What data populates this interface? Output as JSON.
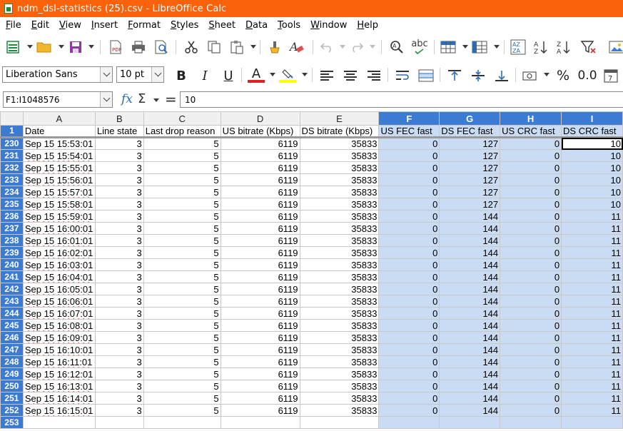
{
  "window": {
    "title": "ndm_dsl-statistics (25).csv - LibreOffice Calc"
  },
  "menu": [
    "File",
    "Edit",
    "View",
    "Insert",
    "Format",
    "Styles",
    "Sheet",
    "Data",
    "Tools",
    "Window",
    "Help"
  ],
  "toolbar": {
    "icons": [
      "new-icon",
      "open-icon",
      "save-icon",
      "export-pdf-icon",
      "print-icon",
      "print-preview-icon",
      "cut-icon",
      "copy-icon",
      "paste-icon",
      "clone-formatting-icon",
      "clear-formatting-icon",
      "undo-icon",
      "redo-icon",
      "find-replace-icon",
      "spelling-icon",
      "row-icon",
      "column-icon",
      "sort-icon",
      "sort-ascending-icon",
      "sort-descending-icon",
      "autofilter-icon",
      "image-icon"
    ],
    "spelling_label": "abc"
  },
  "format": {
    "font_name": "Liberation Sans",
    "font_size": "10 pt",
    "bold_label": "B",
    "italic_label": "I",
    "underline_label": "U",
    "font_color_label": "A",
    "font_color": "#e02020",
    "highlight_color": "#ffff00",
    "percent_label": "%",
    "decimal_label": "0.0"
  },
  "formula": {
    "name_box": "F1:I1048576",
    "fx_label": "fx",
    "sum_label": "Σ",
    "equals_label": "=",
    "content": "10"
  },
  "sheet": {
    "columns": [
      "A",
      "B",
      "C",
      "D",
      "E",
      "F",
      "G",
      "H",
      "I"
    ],
    "selected_columns": [
      "F",
      "G",
      "H",
      "I"
    ],
    "header_row_number": "1",
    "headers": [
      "Date",
      "Line state",
      "Last drop reason",
      "US bitrate (Kbps)",
      "DS bitrate (Kbps)",
      "US FEC fast",
      "DS FEC fast",
      "US CRC fast",
      "DS CRC fast"
    ],
    "rows": [
      {
        "n": "230",
        "cells": [
          "Sep 15 15:53:01",
          "3",
          "5",
          "6119",
          "35833",
          "0",
          "127",
          "0",
          "10"
        ]
      },
      {
        "n": "231",
        "cells": [
          "Sep 15 15:54:01",
          "3",
          "5",
          "6119",
          "35833",
          "0",
          "127",
          "0",
          "10"
        ]
      },
      {
        "n": "232",
        "cells": [
          "Sep 15 15:55:01",
          "3",
          "5",
          "6119",
          "35833",
          "0",
          "127",
          "0",
          "10"
        ]
      },
      {
        "n": "233",
        "cells": [
          "Sep 15 15:56:01",
          "3",
          "5",
          "6119",
          "35833",
          "0",
          "127",
          "0",
          "10"
        ]
      },
      {
        "n": "234",
        "cells": [
          "Sep 15 15:57:01",
          "3",
          "5",
          "6119",
          "35833",
          "0",
          "127",
          "0",
          "10"
        ]
      },
      {
        "n": "235",
        "cells": [
          "Sep 15 15:58:01",
          "3",
          "5",
          "6119",
          "35833",
          "0",
          "127",
          "0",
          "10"
        ]
      },
      {
        "n": "236",
        "cells": [
          "Sep 15 15:59:01",
          "3",
          "5",
          "6119",
          "35833",
          "0",
          "144",
          "0",
          "11"
        ]
      },
      {
        "n": "237",
        "cells": [
          "Sep 15 16:00:01",
          "3",
          "5",
          "6119",
          "35833",
          "0",
          "144",
          "0",
          "11"
        ]
      },
      {
        "n": "238",
        "cells": [
          "Sep 15 16:01:01",
          "3",
          "5",
          "6119",
          "35833",
          "0",
          "144",
          "0",
          "11"
        ]
      },
      {
        "n": "239",
        "cells": [
          "Sep 15 16:02:01",
          "3",
          "5",
          "6119",
          "35833",
          "0",
          "144",
          "0",
          "11"
        ]
      },
      {
        "n": "240",
        "cells": [
          "Sep 15 16:03:01",
          "3",
          "5",
          "6119",
          "35833",
          "0",
          "144",
          "0",
          "11"
        ]
      },
      {
        "n": "241",
        "cells": [
          "Sep 15 16:04:01",
          "3",
          "5",
          "6119",
          "35833",
          "0",
          "144",
          "0",
          "11"
        ]
      },
      {
        "n": "242",
        "cells": [
          "Sep 15 16:05:01",
          "3",
          "5",
          "6119",
          "35833",
          "0",
          "144",
          "0",
          "11"
        ]
      },
      {
        "n": "243",
        "cells": [
          "Sep 15 16:06:01",
          "3",
          "5",
          "6119",
          "35833",
          "0",
          "144",
          "0",
          "11"
        ]
      },
      {
        "n": "244",
        "cells": [
          "Sep 15 16:07:01",
          "3",
          "5",
          "6119",
          "35833",
          "0",
          "144",
          "0",
          "11"
        ]
      },
      {
        "n": "245",
        "cells": [
          "Sep 15 16:08:01",
          "3",
          "5",
          "6119",
          "35833",
          "0",
          "144",
          "0",
          "11"
        ]
      },
      {
        "n": "246",
        "cells": [
          "Sep 15 16:09:01",
          "3",
          "5",
          "6119",
          "35833",
          "0",
          "144",
          "0",
          "11"
        ]
      },
      {
        "n": "247",
        "cells": [
          "Sep 15 16:10:01",
          "3",
          "5",
          "6119",
          "35833",
          "0",
          "144",
          "0",
          "11"
        ]
      },
      {
        "n": "248",
        "cells": [
          "Sep 15 16:11:01",
          "3",
          "5",
          "6119",
          "35833",
          "0",
          "144",
          "0",
          "11"
        ]
      },
      {
        "n": "249",
        "cells": [
          "Sep 15 16:12:01",
          "3",
          "5",
          "6119",
          "35833",
          "0",
          "144",
          "0",
          "11"
        ]
      },
      {
        "n": "250",
        "cells": [
          "Sep 15 16:13:01",
          "3",
          "5",
          "6119",
          "35833",
          "0",
          "144",
          "0",
          "11"
        ]
      },
      {
        "n": "251",
        "cells": [
          "Sep 15 16:14:01",
          "3",
          "5",
          "6119",
          "35833",
          "0",
          "144",
          "0",
          "11"
        ]
      },
      {
        "n": "252",
        "cells": [
          "Sep 15 16:15:01",
          "3",
          "5",
          "6119",
          "35833",
          "0",
          "144",
          "0",
          "11"
        ]
      },
      {
        "n": "253",
        "cells": [
          "",
          "",
          "",
          "",
          "",
          "",
          "",
          "",
          ""
        ]
      }
    ]
  },
  "colors": {
    "titlebar": "#f7620a",
    "selection_header": "#3b7bd4",
    "selection_fill": "#c9dcf3"
  }
}
